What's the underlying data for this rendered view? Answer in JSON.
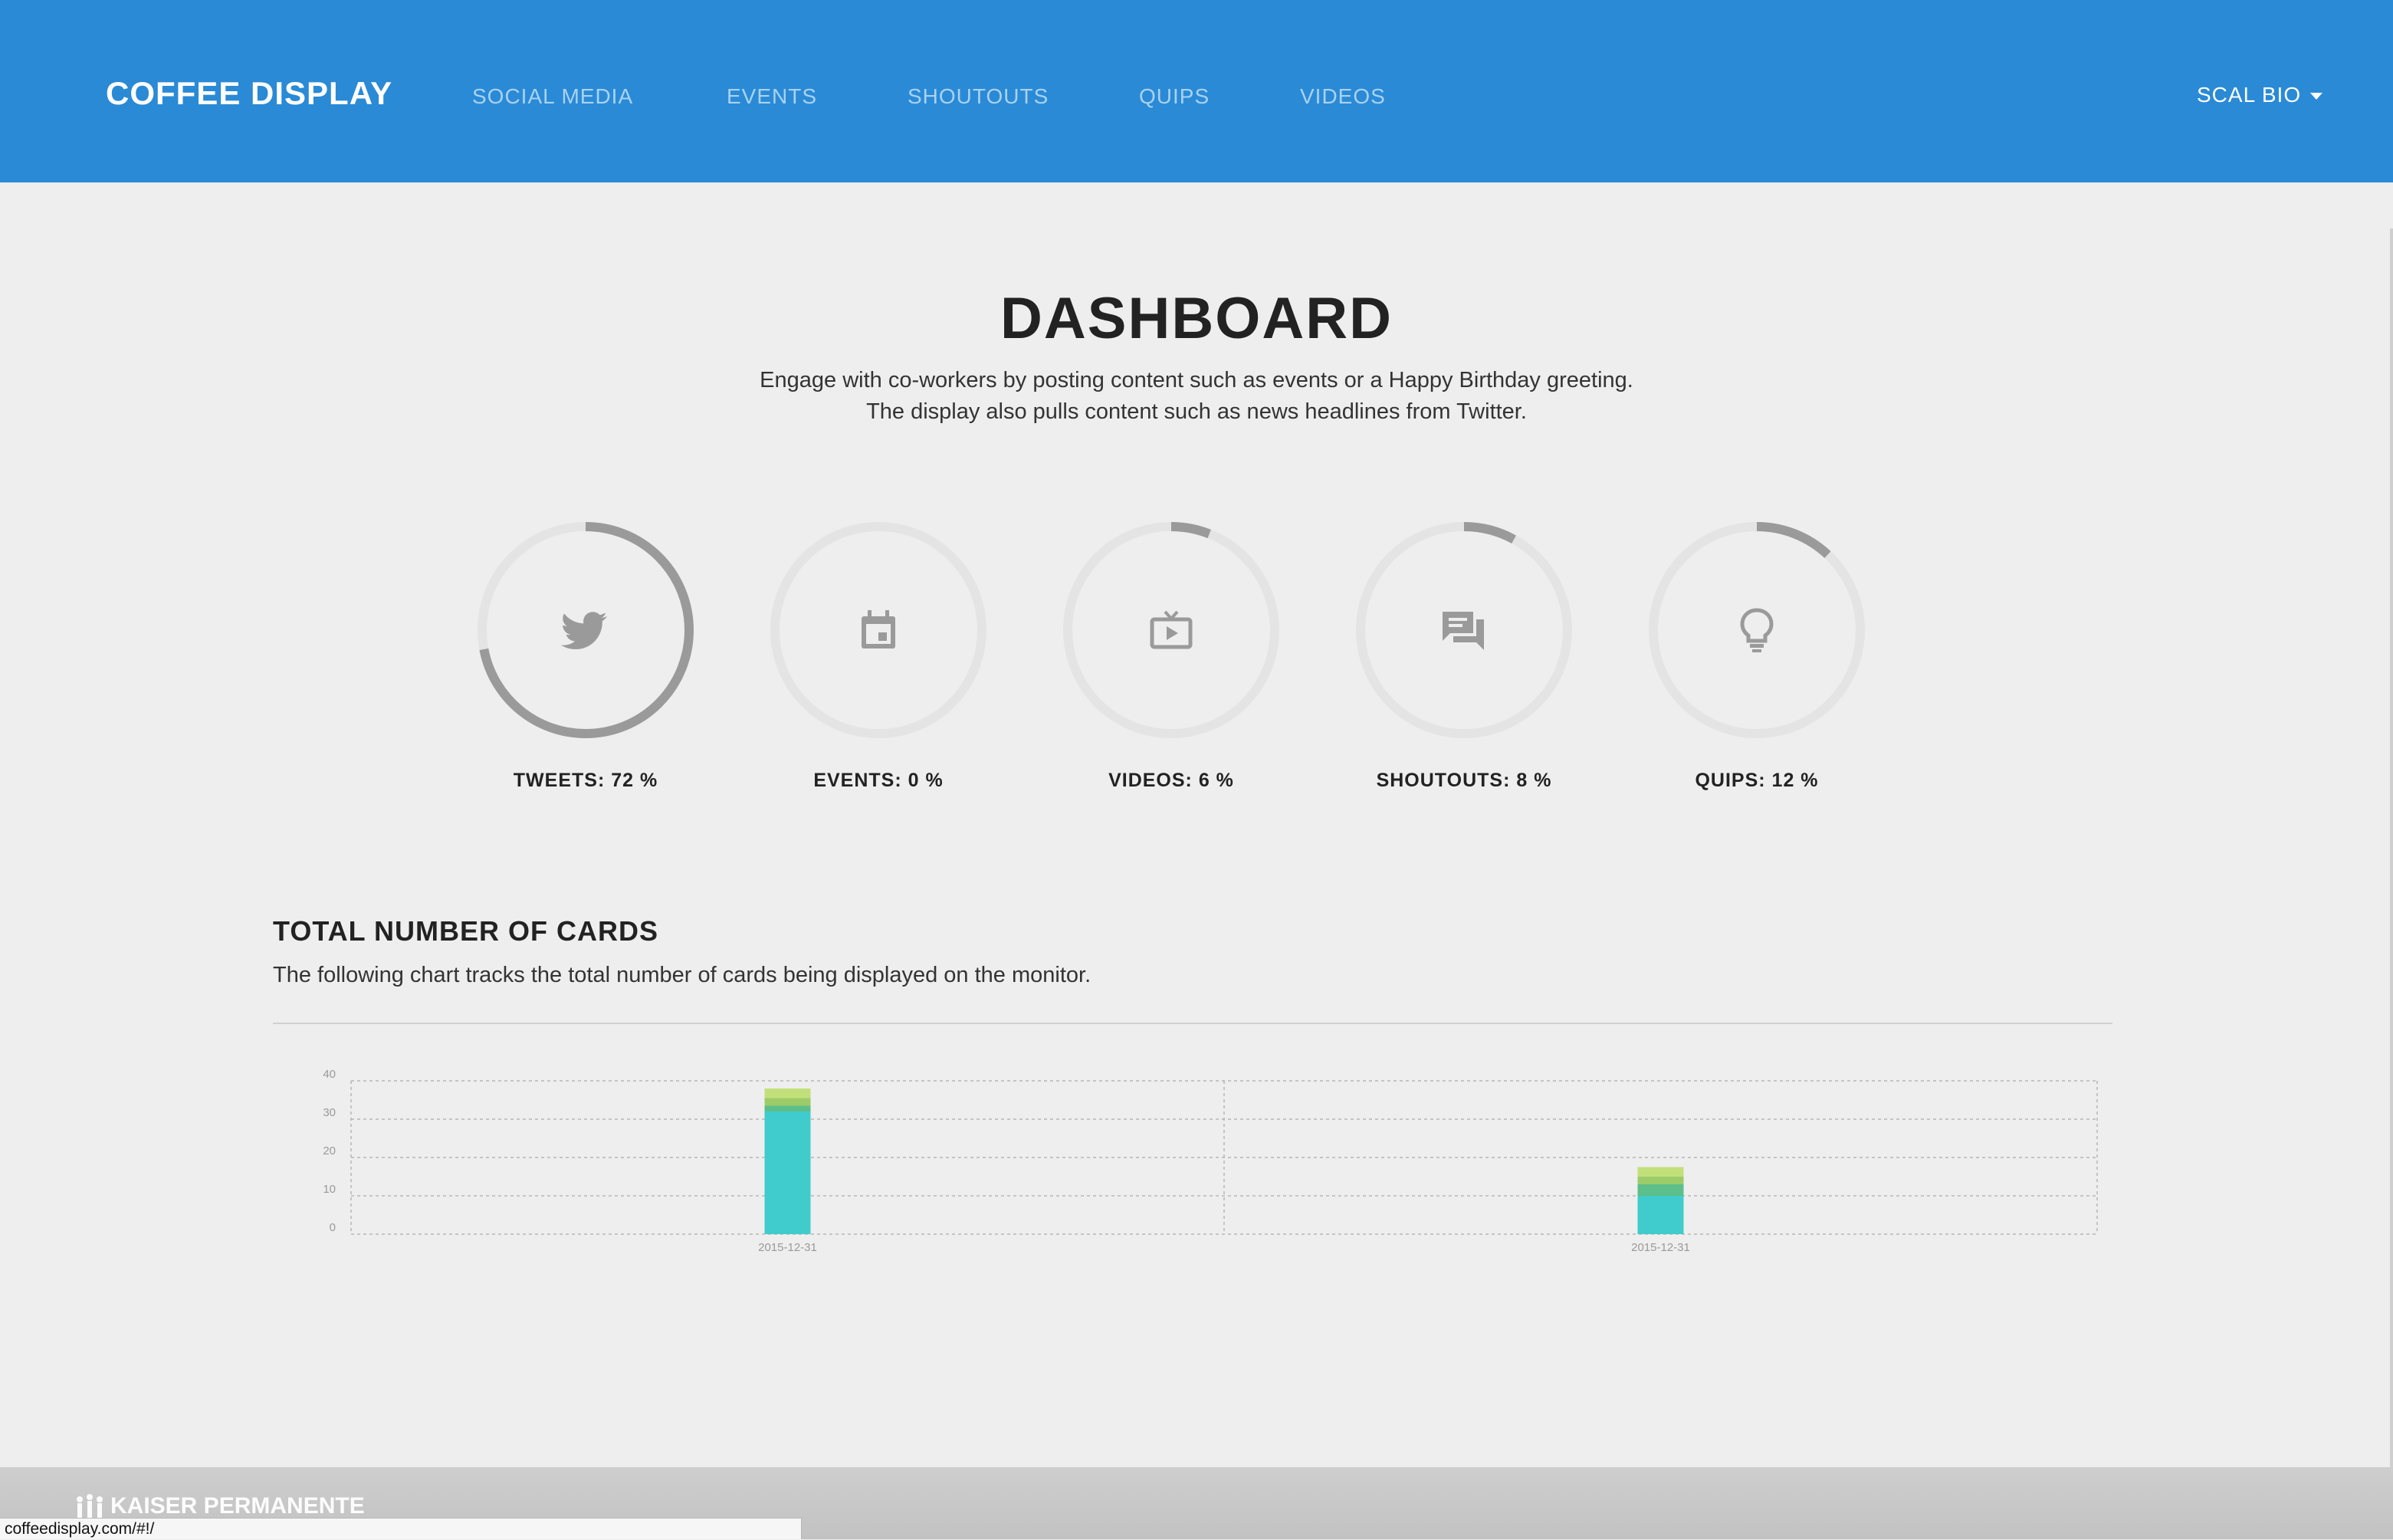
{
  "header": {
    "brand": "COFFEE DISPLAY",
    "nav": [
      "SOCIAL MEDIA",
      "EVENTS",
      "SHOUTOUTS",
      "QUIPS",
      "VIDEOS"
    ],
    "user_menu": "SCAL BIO"
  },
  "dashboard": {
    "title": "DASHBOARD",
    "description": "Engage with co-workers by posting content such as events or a Happy Birthday greeting. The display also pulls content such as news headlines from Twitter."
  },
  "stats": [
    {
      "label": "TWEETS: 72 %",
      "percent": 72,
      "icon": "twitter-icon"
    },
    {
      "label": "EVENTS: 0 %",
      "percent": 0,
      "icon": "calendar-icon"
    },
    {
      "label": "VIDEOS: 6 %",
      "percent": 6,
      "icon": "tv-icon"
    },
    {
      "label": "SHOUTOUTS: 8 %",
      "percent": 8,
      "icon": "chat-icon"
    },
    {
      "label": "QUIPS: 12 %",
      "percent": 12,
      "icon": "lightbulb-icon"
    }
  ],
  "cards": {
    "title": "TOTAL NUMBER OF CARDS",
    "description": "The following chart tracks the total number of cards being displayed on the monitor."
  },
  "chart_data": {
    "type": "bar",
    "stacked": true,
    "categories": [
      "2015-12-31",
      "2015-12-31"
    ],
    "series": [
      {
        "color": "#40cccc",
        "values": [
          32,
          10
        ]
      },
      {
        "color": "#5cbf8a",
        "values": [
          1.5,
          3
        ]
      },
      {
        "color": "#9ccc6a",
        "values": [
          2,
          2
        ]
      },
      {
        "color": "#c2e07a",
        "values": [
          2.5,
          2.5
        ]
      }
    ],
    "ylim": [
      0,
      40
    ],
    "yticks": [
      0,
      10,
      20,
      30,
      40
    ],
    "grid": true
  },
  "footer": {
    "logo": "KAISER PERMANENTE",
    "status_url": "coffeedisplay.com/#!/"
  },
  "colors": {
    "header": "#2a8ad6",
    "ring_track": "#e4e4e4",
    "ring_fill": "#9a9a9a",
    "background": "#eeeeee"
  }
}
